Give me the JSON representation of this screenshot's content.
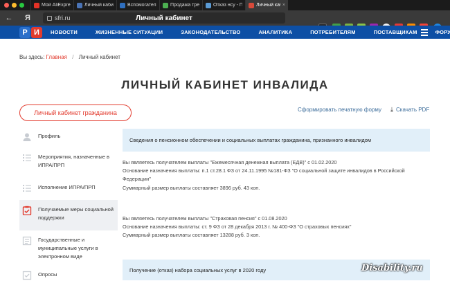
{
  "browser": {
    "tabs": [
      {
        "label": "Мой AliExpress: У",
        "color": "#e43226",
        "active": false
      },
      {
        "label": "Личный кабинет",
        "color": "#4a73b5",
        "active": false
      },
      {
        "label": "Вспомогательный",
        "color": "#2f6fbf",
        "active": false
      },
      {
        "label": "Продажа трехком",
        "color": "#4caf50",
        "active": false
      },
      {
        "label": "Отказ нсу - Пенси",
        "color": "#5b9bd5",
        "active": false
      },
      {
        "label": "Личный кабине",
        "color": "#d84a3a",
        "active": true
      }
    ],
    "address_host": "sfri.ru",
    "page_title": "Личный кабинет",
    "back_icon": "←",
    "yandex_icon": "Я"
  },
  "site": {
    "logo_left": "Р",
    "logo_right": "И",
    "logo_left_color": "#2b6fca",
    "logo_right_color": "#e23b2e",
    "menu": [
      "НОВОСТИ",
      "ЖИЗНЕННЫЕ СИТУАЦИИ",
      "ЗАКОНОДАТЕЛЬСТВО",
      "АНАЛИТИКА",
      "ПОТРЕБИТЕЛЯМ",
      "ПОСТАВЩИКАМ",
      "ФОРУМ"
    ]
  },
  "breadcrumb": {
    "prefix": "Вы здесь:",
    "home": "Главная",
    "separator": "/",
    "current": "Личный кабинет"
  },
  "page": {
    "heading": "ЛИЧНЫЙ КАБИНЕТ ИНВАЛИДА",
    "cabinet_button": "Личный кабинет гражданина",
    "print_link": "Сформировать печатную форму",
    "pdf_link": "Скачать PDF"
  },
  "sidebar": {
    "items": [
      {
        "label": "Профиль",
        "icon": "user-icon",
        "active": false
      },
      {
        "label": "Мероприятия, назначенные в ИПРА/ПРП",
        "icon": "list-icon",
        "active": false
      },
      {
        "label": "Исполнение ИПРА/ПРП",
        "icon": "list-icon",
        "active": false
      },
      {
        "label": "Получаемые меры социальной поддержки",
        "icon": "clipboard-check-icon",
        "active": true
      },
      {
        "label": "Государственные и муниципальные услуги в электронном виде",
        "icon": "form-icon",
        "active": false
      },
      {
        "label": "Опросы",
        "icon": "survey-icon",
        "active": false
      }
    ]
  },
  "content": {
    "section1_title": "Сведения о пенсионном обеспечении и социальных выплатах гражданина, признанного инвалидом",
    "block1": [
      "Вы являетесь получателем выплаты \"Ежемесячная денежная выплата (ЕДВ)\" с 01.02.2020",
      "Основание назначения выплаты: п.1 ст.28.1 ФЗ от 24.11.1995 №181-ФЗ \"О социальной защите инвалидов в Российской Федерации\"",
      "Суммарный размер выплаты составляет 3896 руб. 43 коп."
    ],
    "block2": [
      "Вы являетесь получателем выплаты \"Страховая пенсия\" с 01.08.2020",
      "Основание назначения выплаты: ст. 9 ФЗ от 28 декабря 2013 г. № 400-ФЗ \"О страховых пенсиях\"",
      "Суммарный размер выплаты составляет 13288 руб. 3 коп."
    ],
    "section2_title": "Получение (отказ) набора социальных услуг в 2020 году"
  },
  "watermark": "Disability.ru"
}
